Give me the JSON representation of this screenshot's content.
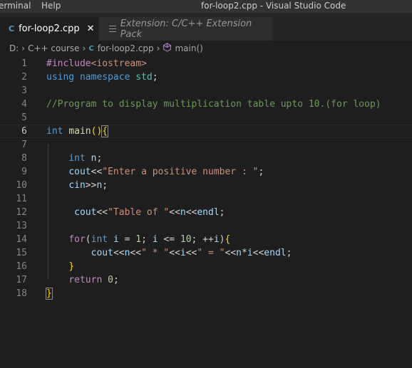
{
  "titlebar": {
    "menu": [
      "erminal",
      "Help"
    ],
    "window_title": "for-loop2.cpp - Visual Studio Code"
  },
  "tabs": [
    {
      "label": "for-loop2.cpp",
      "icon": "cpp-file-icon",
      "active": true,
      "close": "✕"
    },
    {
      "label": "Extension: C/C++ Extension Pack",
      "icon": "extension-preview-icon",
      "active": false
    }
  ],
  "breadcrumb": {
    "items": [
      "D:",
      "C++ course",
      "for-loop2.cpp",
      "main()"
    ],
    "separator": "›",
    "file_icon_text": "C",
    "function_icon": "cube-icon"
  },
  "editor": {
    "current_line": 6,
    "line_numbers": [
      "1",
      "2",
      "3",
      "4",
      "5",
      "6",
      "7",
      "8",
      "9",
      "10",
      "11",
      "12",
      "13",
      "14",
      "15",
      "16",
      "17",
      "18"
    ],
    "lines": [
      [
        [
          "p",
          "#include"
        ],
        [
          "s",
          "<iostream>"
        ]
      ],
      [
        [
          "k",
          "using"
        ],
        [
          "t",
          " "
        ],
        [
          "k",
          "namespace"
        ],
        [
          "t",
          " "
        ],
        [
          "t",
          "std"
        ],
        [
          "d",
          ";"
        ]
      ],
      [],
      [
        [
          "c",
          "//Program to display multiplication table upto 10.(for loop)"
        ]
      ],
      [],
      [
        [
          "k",
          "int"
        ],
        [
          "d",
          " "
        ],
        [
          "f",
          "main"
        ],
        [
          "bracket",
          "()"
        ],
        [
          "bracket-box",
          "{"
        ]
      ],
      [],
      [
        [
          "d",
          "    "
        ],
        [
          "k",
          "int"
        ],
        [
          "d",
          " "
        ],
        [
          "v",
          "n"
        ],
        [
          "d",
          ";"
        ]
      ],
      [
        [
          "d",
          "    "
        ],
        [
          "v",
          "cout"
        ],
        [
          "d",
          "<<"
        ],
        [
          "s",
          "\"Enter a positive number : \""
        ],
        [
          "d",
          ";"
        ]
      ],
      [
        [
          "d",
          "    "
        ],
        [
          "v",
          "cin"
        ],
        [
          "d",
          ">>"
        ],
        [
          "v",
          "n"
        ],
        [
          "d",
          ";"
        ]
      ],
      [],
      [
        [
          "d",
          "     "
        ],
        [
          "v",
          "cout"
        ],
        [
          "d",
          "<<"
        ],
        [
          "s",
          "\"Table of \""
        ],
        [
          "d",
          "<<"
        ],
        [
          "v",
          "n"
        ],
        [
          "d",
          "<<"
        ],
        [
          "v",
          "endl"
        ],
        [
          "d",
          ";"
        ]
      ],
      [],
      [
        [
          "d",
          "    "
        ],
        [
          "p",
          "for"
        ],
        [
          "d",
          "("
        ],
        [
          "k",
          "int"
        ],
        [
          "d",
          " "
        ],
        [
          "v",
          "i"
        ],
        [
          "d",
          " = "
        ],
        [
          "n",
          "1"
        ],
        [
          "d",
          "; "
        ],
        [
          "v",
          "i"
        ],
        [
          "d",
          " <= "
        ],
        [
          "n",
          "10"
        ],
        [
          "d",
          "; ++"
        ],
        [
          "v",
          "i"
        ],
        [
          "d",
          ")"
        ],
        [
          "bracket",
          "{"
        ]
      ],
      [
        [
          "d",
          "        "
        ],
        [
          "v",
          "cout"
        ],
        [
          "d",
          "<<"
        ],
        [
          "v",
          "n"
        ],
        [
          "d",
          "<<"
        ],
        [
          "s",
          "\" * \""
        ],
        [
          "d",
          "<<"
        ],
        [
          "v",
          "i"
        ],
        [
          "d",
          "<<"
        ],
        [
          "s",
          "\" = \""
        ],
        [
          "d",
          "<<"
        ],
        [
          "v",
          "n"
        ],
        [
          "d",
          "*"
        ],
        [
          "v",
          "i"
        ],
        [
          "d",
          "<<"
        ],
        [
          "v",
          "endl"
        ],
        [
          "d",
          ";"
        ]
      ],
      [
        [
          "d",
          "    "
        ],
        [
          "bracket",
          "}"
        ]
      ],
      [
        [
          "d",
          "    "
        ],
        [
          "p",
          "return"
        ],
        [
          "d",
          " "
        ],
        [
          "n",
          "0"
        ],
        [
          "d",
          ";"
        ]
      ],
      [
        [
          "bracket-box",
          "}"
        ]
      ]
    ]
  },
  "colors": {
    "background": "#1e1e1e",
    "keyword": "#569cd6",
    "string": "#ce9178",
    "comment": "#6a9955",
    "control": "#c586c0",
    "number": "#b5cea8",
    "function": "#dcdcaa",
    "variable": "#9cdcfe",
    "type": "#4ec9b0",
    "bracket": "#ffd700"
  }
}
